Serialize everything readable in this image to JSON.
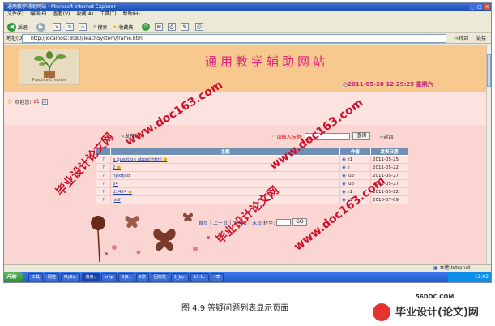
{
  "browser": {
    "window_title": "通用教学辅助网站 - Microsoft Internet Explorer",
    "menu": [
      "文件(F)",
      "编辑(E)",
      "查看(V)",
      "收藏(A)",
      "工具(T)",
      "帮助(H)"
    ],
    "back_label": "后退",
    "search_label": "搜索",
    "favorites_label": "收藏夹",
    "address_label": "地址(D)",
    "address_url": "http://localhost:8080/TeachSystem/frame.html",
    "go_label": "转到",
    "links_label": "链接",
    "status_zone": "本地 Intranet"
  },
  "site": {
    "title": "通用教学辅助网站",
    "logo_caption": "Practice Creative",
    "datetime": "2011-05-28 12:29:25 星期六",
    "welcome_text": "欢迎您!",
    "username": "z1"
  },
  "questions": {
    "publish_link": "发布疑问",
    "search_label": "请输入标题:",
    "search_button": "查询",
    "back_link": "返回",
    "columns": [
      "主题",
      "作者",
      "发表日期"
    ],
    "rows": [
      {
        "subject": "a question about html",
        "author": "z1",
        "date": "2011-05-25"
      },
      {
        "subject": "2",
        "author": "li",
        "date": "2011-05-22"
      },
      {
        "subject": "hjsdfjsd",
        "author": "luo",
        "date": "2011-05-27"
      },
      {
        "subject": "54",
        "author": "luo",
        "date": "2011-05-27"
      },
      {
        "subject": "d1424",
        "author": "z1",
        "date": "2011-05-22"
      },
      {
        "subject": "jsdf",
        "author": "z1",
        "date": "2010-07-09"
      }
    ],
    "pager": {
      "first": "首页",
      "prev": "上一页",
      "next": "下一页",
      "last": "末页",
      "goto_label": "转至:",
      "go_button": "GO"
    }
  },
  "taskbar": {
    "start": "开始",
    "tasks": [
      "工具",
      "网络",
      "MyEc..",
      "通用..",
      "ar|ip",
      "B|B..",
      "5章",
      "回收站",
      "1_by..",
      "13.1..",
      "4章"
    ],
    "clock": "13:02"
  },
  "figure": {
    "caption": "图 4.9  答疑问题列表显示页面",
    "brand_url": "56DOC.COM",
    "brand_name": "毕业设计(论文)网"
  },
  "watermarks": {
    "domain": "www.doc163.com",
    "slogan": "毕业设计论文网"
  },
  "colors": {
    "header_bg": "#f8c98f",
    "title_color": "#e0247a",
    "table_header_bg": "#6f8fb4",
    "page_bg": "#fde3e0",
    "watermark": "#d0102a"
  }
}
